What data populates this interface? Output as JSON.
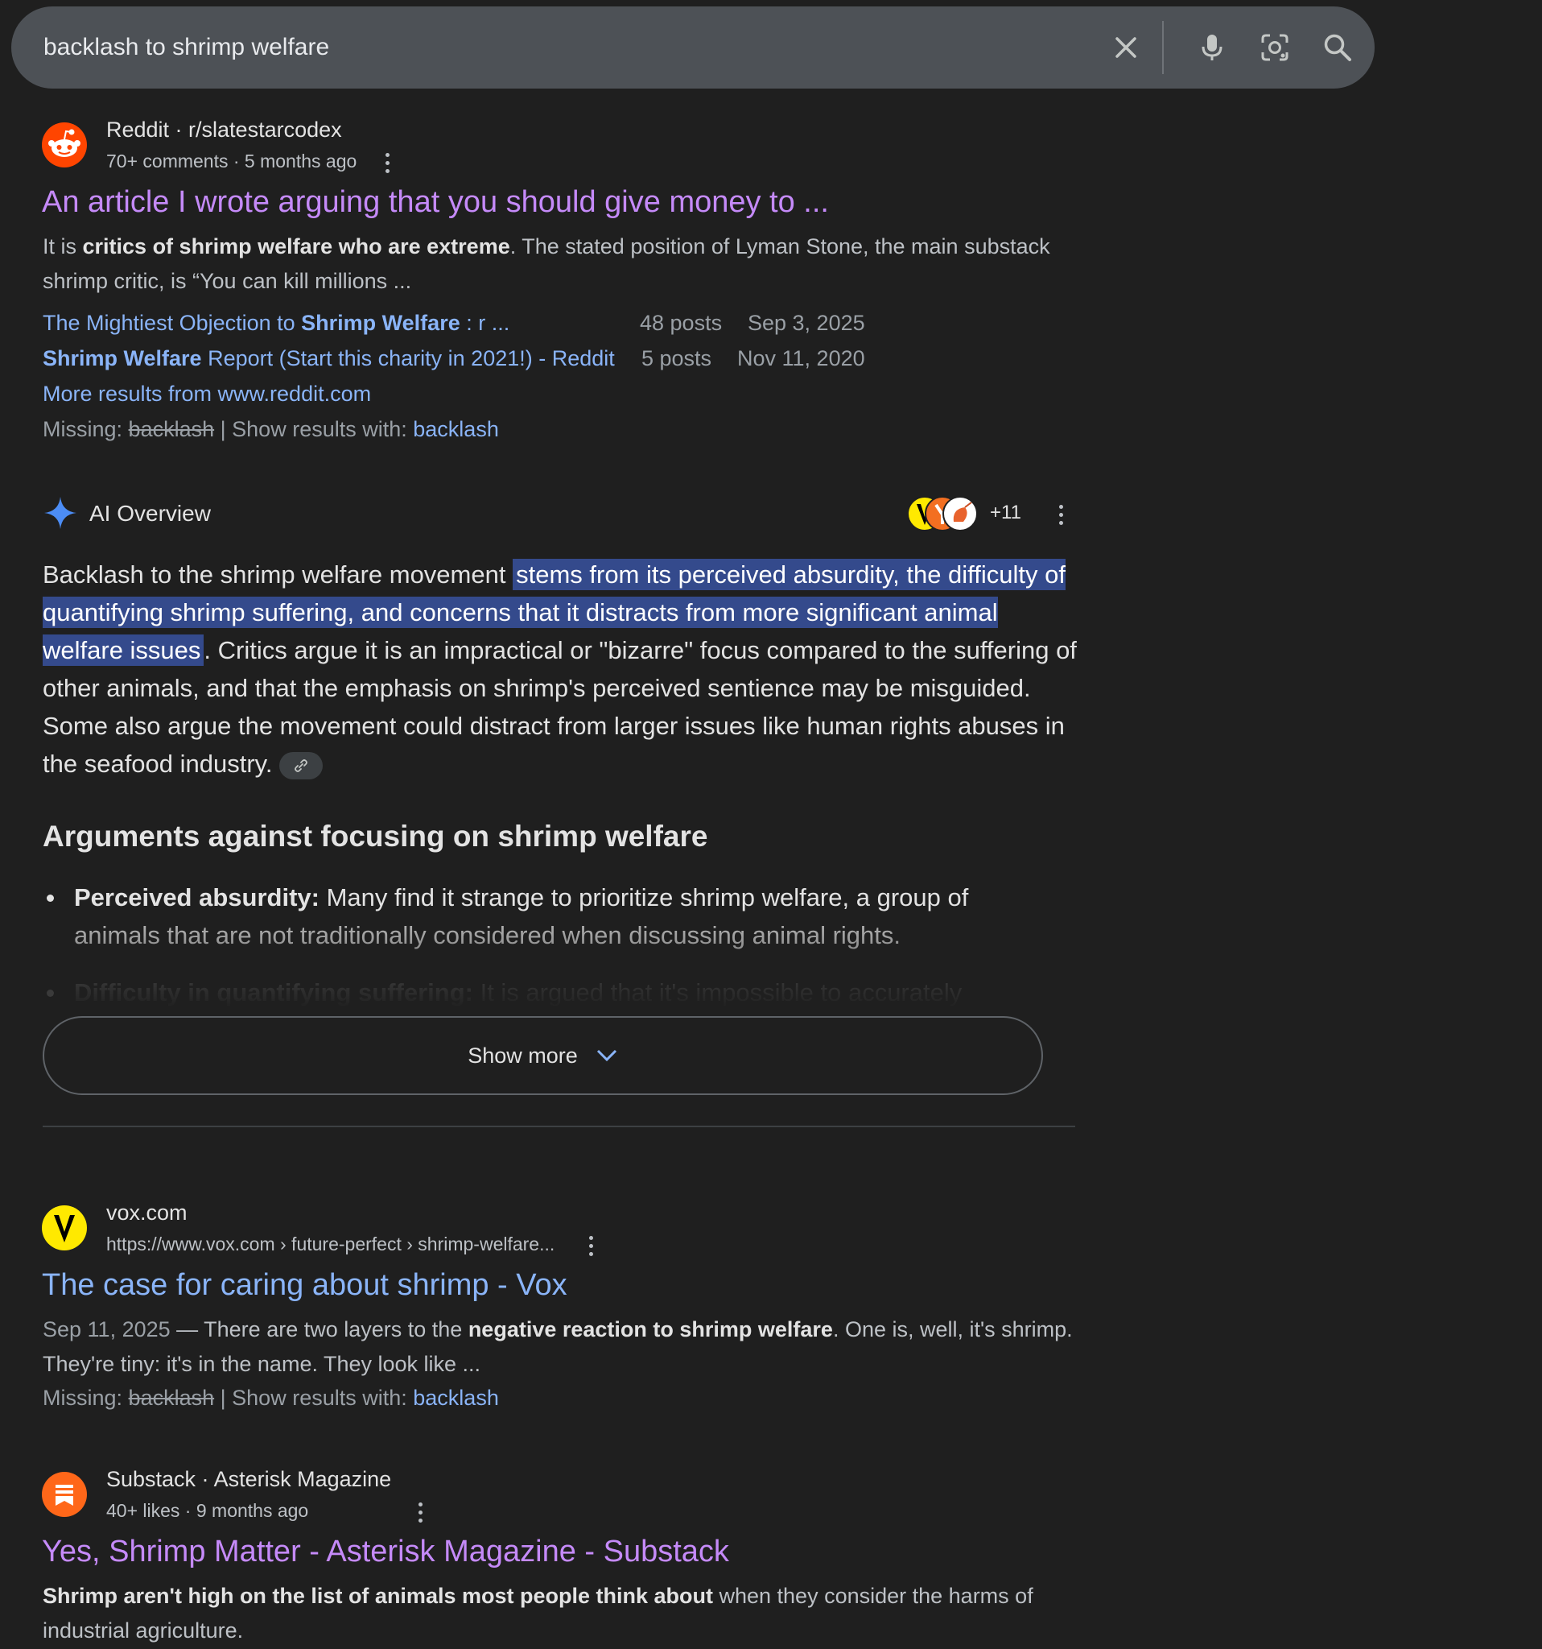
{
  "search": {
    "query": "backlash to shrimp welfare"
  },
  "result1": {
    "source": "Reddit · r/slatestarcodex",
    "meta": "70+ comments · 5 months ago",
    "title": "An article I wrote arguing that you should give money to ...",
    "snippet_1": "It is ",
    "snippet_bold": "critics of shrimp welfare who are extreme",
    "snippet_2": ". The stated position of Lyman Stone, the main substack shrimp critic, is “You can kill millions ...",
    "sublinks": [
      {
        "pre": "The Mightiest Objection to ",
        "bold": "Shrimp Welfare",
        "post": " : r ...",
        "posts": "48 posts",
        "date": "Sep 3, 2025"
      },
      {
        "pre": "",
        "bold": "Shrimp Welfare",
        "post": " Report (Start this charity in 2021!) - Reddit",
        "posts": "5 posts",
        "date": "Nov 11, 2020"
      }
    ],
    "more_results": "More results from www.reddit.com",
    "missing_label": "Missing:",
    "missing_term": "backlash",
    "show_results_with": "| Show results with:",
    "show_term": "backlash"
  },
  "ai_overview": {
    "label": "AI Overview",
    "source_count": "+11",
    "text_pre": "Backlash to the shrimp welfare movement ",
    "text_highlight": "stems from its perceived absurdity, the difficulty of quantifying shrimp suffering, and concerns that it distracts from more significant animal welfare issues",
    "text_post": ". Critics argue it is an impractical or \"bizarre\" focus compared to the suffering of other animals, and that the emphasis on shrimp's perceived sentience may be misguided. Some also argue the movement could distract from larger issues like human rights abuses in the seafood industry.",
    "heading": "Arguments against focusing on shrimp welfare",
    "bullets": [
      {
        "bold": "Perceived absurdity:",
        "text": " Many find it strange to prioritize shrimp welfare, a group of animals that are not traditionally considered when discussing animal rights."
      },
      {
        "bold": "Difficulty in quantifying suffering:",
        "text": " It is argued that it's impossible to accurately"
      }
    ],
    "show_more": "Show more"
  },
  "result2": {
    "source": "vox.com",
    "url": "https://www.vox.com › future-perfect › shrimp-welfare...",
    "title": "The case for caring about shrimp - Vox",
    "date": "Sep 11, 2025",
    "snippet_1": " — There are two layers to the ",
    "snippet_bold": "negative reaction to shrimp welfare",
    "snippet_2": ". One is, well, it's shrimp. They're tiny: it's in the name. They look like ...",
    "missing_label": "Missing:",
    "missing_term": "backlash",
    "show_results_with": "| Show results with:",
    "show_term": "backlash"
  },
  "result3": {
    "source": "Substack · Asterisk Magazine",
    "meta": "40+ likes · 9 months ago",
    "title": "Yes, Shrimp Matter - Asterisk Magazine - Substack",
    "snippet_bold": "Shrimp aren't high on the list of animals most people think about",
    "snippet_2": " when they consider the harms of industrial agriculture."
  },
  "colors": {
    "background": "#1f1f1f",
    "visited_link": "#c58af9",
    "link": "#8ab4f8",
    "highlight": "#344a8c",
    "reddit": "#ff4500",
    "vox_yellow": "#ffe900"
  }
}
